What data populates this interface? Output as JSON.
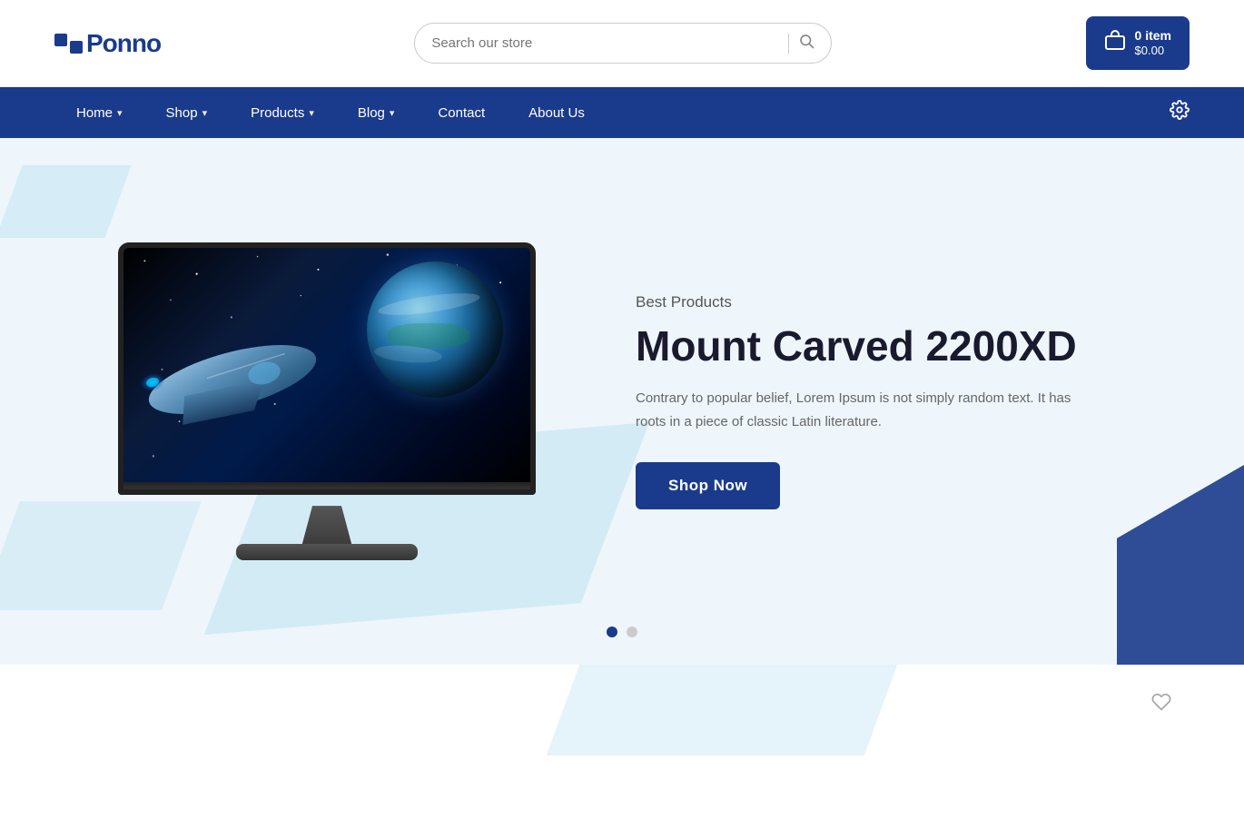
{
  "header": {
    "logo_text": "Ponno",
    "search_placeholder": "Search our store",
    "cart_items": "0 item",
    "cart_price": "$0.00"
  },
  "navbar": {
    "items": [
      {
        "label": "Home",
        "has_dropdown": true
      },
      {
        "label": "Shop",
        "has_dropdown": true
      },
      {
        "label": "Products",
        "has_dropdown": true
      },
      {
        "label": "Blog",
        "has_dropdown": true
      },
      {
        "label": "Contact",
        "has_dropdown": false
      },
      {
        "label": "About Us",
        "has_dropdown": false
      }
    ]
  },
  "hero": {
    "subtitle": "Best Products",
    "title": "Mount Carved 2200XD",
    "description": "Contrary to popular belief, Lorem Ipsum is not simply random text. It has roots in a piece of classic Latin literature.",
    "cta_label": "Shop Now"
  },
  "carousel": {
    "dots": [
      {
        "active": true
      },
      {
        "active": false
      }
    ]
  }
}
